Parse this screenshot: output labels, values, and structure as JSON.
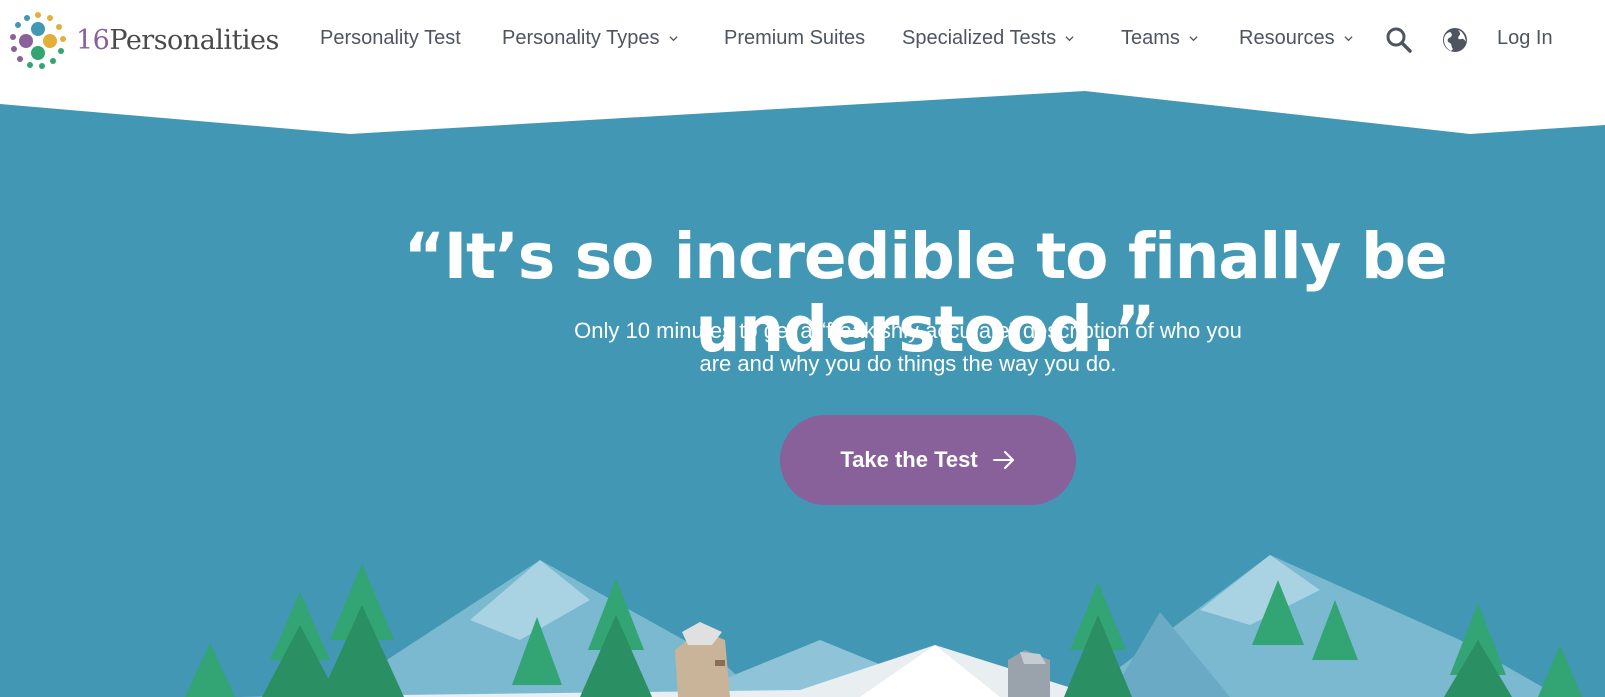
{
  "brand": {
    "logo_number": "16",
    "logo_word": "Personalities",
    "colors": {
      "purple": "#88619a",
      "teal": "#4298b4",
      "yellow": "#e4ae3a",
      "green": "#33a474",
      "hero_bg": "#4298b4"
    }
  },
  "nav": {
    "items": [
      {
        "label": "Personality Test",
        "has_dropdown": false
      },
      {
        "label": "Personality Types",
        "has_dropdown": true
      },
      {
        "label": "Premium Suites",
        "has_dropdown": false
      },
      {
        "label": "Specialized Tests",
        "has_dropdown": true
      },
      {
        "label": "Teams",
        "has_dropdown": true
      },
      {
        "label": "Resources",
        "has_dropdown": true
      }
    ],
    "search_icon": "search-icon",
    "language_icon": "globe-icon",
    "login_label": "Log In"
  },
  "hero": {
    "headline": "“It’s so incredible to finally be understood.”",
    "subtext_line1": "Only 10 minutes to get a “freakishly accurate” description of who you",
    "subtext_line2": "are and why you do things the way you do.",
    "cta_label": "Take the Test",
    "cta_icon": "arrow-right-icon"
  }
}
